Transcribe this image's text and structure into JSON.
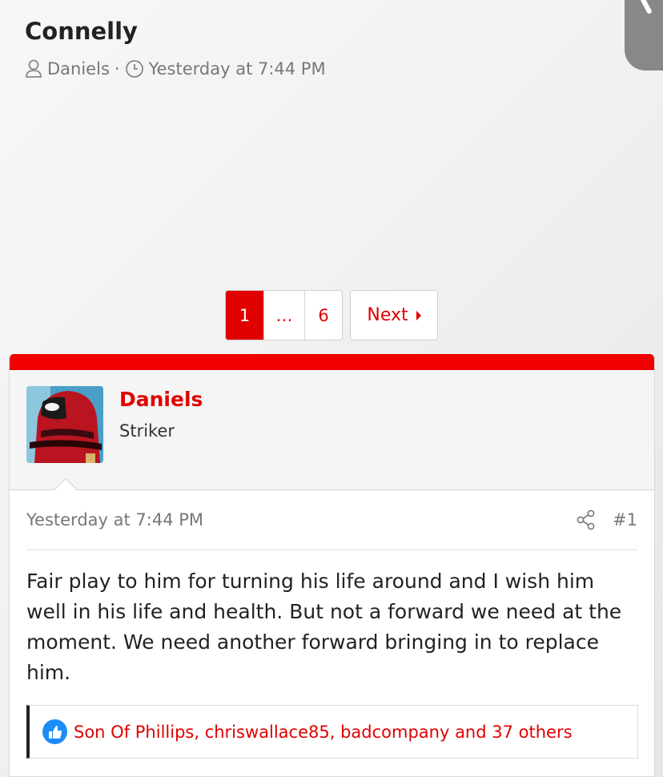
{
  "thread": {
    "title": "Connelly",
    "author": "Daniels",
    "separator": "·",
    "date": "Yesterday at 7:44 PM"
  },
  "pagination": {
    "current": "1",
    "ellipsis": "…",
    "last": "6",
    "next_label": "Next"
  },
  "post": {
    "username": "Daniels",
    "user_title": "Striker",
    "date": "Yesterday at 7:44 PM",
    "number": "#1",
    "body": "Fair play to him for turning his life around and I wish him well in his life and health. But not a forward we need at the moment. We need another forward bringing in to replace him.",
    "reactions_text": "Son Of Phillips, chriswallace85, badcompany and 37 others"
  },
  "colors": {
    "accent": "#e00000",
    "like": "#1d8cf8"
  },
  "icons": {
    "author": "user-icon",
    "time": "clock-icon",
    "share": "share-icon",
    "like": "thumbs-up-icon"
  }
}
